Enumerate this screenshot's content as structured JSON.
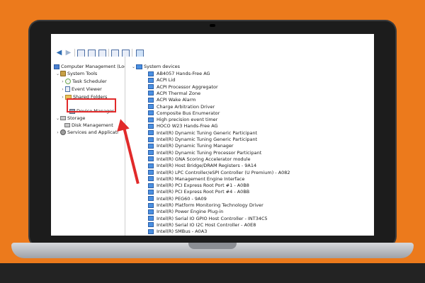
{
  "left_tree": {
    "root": "Computer Management (Local",
    "system_tools": "System Tools",
    "task_scheduler": "Task Scheduler",
    "event_viewer": "Event Viewer",
    "shared_folders": "Shared Folders",
    "device_manager": "Device Manager",
    "storage": "Storage",
    "disk_management": "Disk Management",
    "services": "Services and Applicati"
  },
  "device_tree": {
    "category": "System devices",
    "devices": [
      "AB4057 Hands-Free AG",
      "ACPI Lid",
      "ACPI Processor Aggregator",
      "ACPI Thermal Zone",
      "ACPI Wake Alarm",
      "Charge Arbitration Driver",
      "Composite Bus Enumerator",
      "High precision event timer",
      "HOCO W23 Hands-Free AG",
      "Intel(R) Dynamic Tuning Generic Participant",
      "Intel(R) Dynamic Tuning Generic Participant",
      "Intel(R) Dynamic Tuning Manager",
      "Intel(R) Dynamic Tuning Processor Participant",
      "Intel(R) GNA Scoring Accelerator module",
      "Intel(R) Host Bridge/DRAM Registers - 9A14",
      "Intel(R) LPC Controller/eSPI Controller (U Premium) - A082",
      "Intel(R) Management Engine Interface",
      "Intel(R) PCI Express Root Port #1 - A0B8",
      "Intel(R) PCI Express Root Port #4 - A0BB",
      "Intel(R) PEG60 - 9A09",
      "Intel(R) Platform Monitoring Technology Driver",
      "Intel(R) Power Engine Plug-in",
      "Intel(R) Serial IO GPIO Host Controller - INT34C5",
      "Intel(R) Serial IO I2C Host Controller - A0E8",
      "Intel(R) SMBus - A0A3"
    ]
  },
  "colors": {
    "background": "#ec7a1c",
    "annotation": "#e12a2a"
  }
}
